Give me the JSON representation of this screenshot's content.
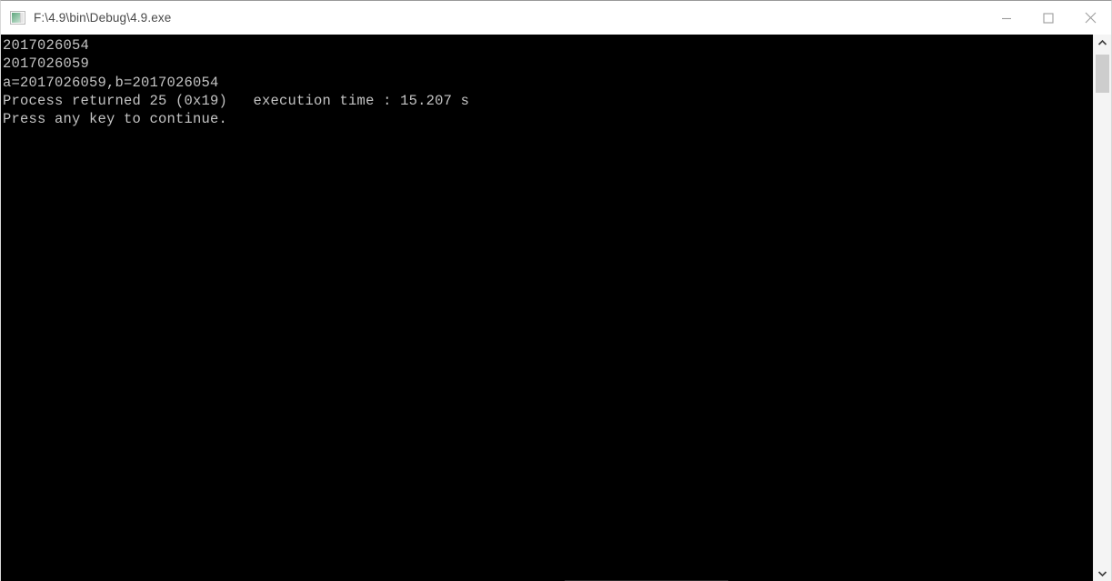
{
  "window": {
    "title": "F:\\4.9\\bin\\Debug\\4.9.exe",
    "icon": "console-app-icon",
    "background_color": "#000000",
    "titlebar_color": "#ffffff"
  },
  "titlebar_controls": {
    "minimize_label": "Minimize",
    "maximize_label": "Maximize",
    "close_label": "Close"
  },
  "console": {
    "text_color": "#c3c3c3",
    "lines": [
      "2017026054",
      "2017026059",
      "a=2017026059,b=2017026054",
      "Process returned 25 (0x19)   execution time : 15.207 s",
      "Press any key to continue."
    ],
    "line_0": "2017026054",
    "line_1": "2017026059",
    "line_2": "a=2017026059,b=2017026054",
    "line_3": "Process returned 25 (0x19)   execution time : 15.207 s",
    "line_4": "Press any key to continue."
  },
  "scrollbar": {
    "up_arrow_label": "Scroll up",
    "down_arrow_label": "Scroll down",
    "thumb_label": "Vertical scroll thumb",
    "track_color": "#f4f4f4",
    "thumb_color": "#cdcdcd"
  }
}
